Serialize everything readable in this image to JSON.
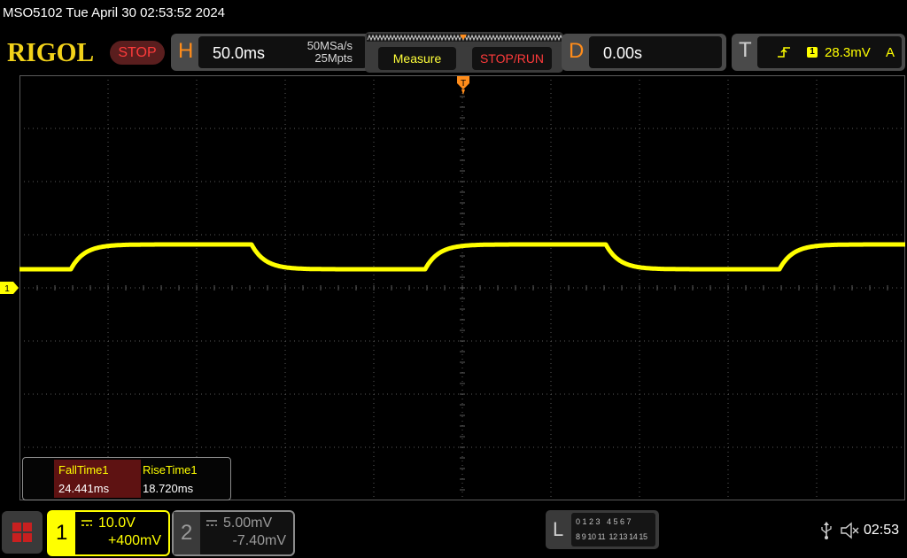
{
  "titlebar": {
    "text": "MSO5102  Tue April 30 02:53:52 2024"
  },
  "logo": "RIGOL",
  "run_status": "STOP",
  "horizontal": {
    "letter": "H",
    "timebase": "50.0ms",
    "sample_rate": "50MSa/s",
    "memory_depth": "25Mpts"
  },
  "buttons": {
    "measure": "Measure",
    "stop_run": "STOP/RUN"
  },
  "delay": {
    "letter": "D",
    "value": "0.00s"
  },
  "trigger": {
    "letter": "T",
    "source": "1",
    "level": "28.3mV",
    "mode": "A",
    "marker": "T"
  },
  "channel_marker": "1",
  "measurements": [
    {
      "name": "FallTime1",
      "value": "24.441ms"
    },
    {
      "name": "RiseTime1",
      "value": "18.720ms"
    }
  ],
  "channels": [
    {
      "num": "1",
      "scale": "10.0V",
      "offset": "+400mV",
      "color": "#ffff00"
    },
    {
      "num": "2",
      "scale": "5.00mV",
      "offset": "-7.40mV",
      "color": "#8a8a8a"
    }
  ],
  "logic": {
    "letter": "L",
    "row1": "0 1 2 3   4 5 6 7",
    "row2": "8 9 10 11  12 13 14 15"
  },
  "status": {
    "time": "02:53"
  },
  "colors": {
    "trace": "#ffff00",
    "accent": "#ff8c1a",
    "grid": "#5a5a5a"
  }
}
